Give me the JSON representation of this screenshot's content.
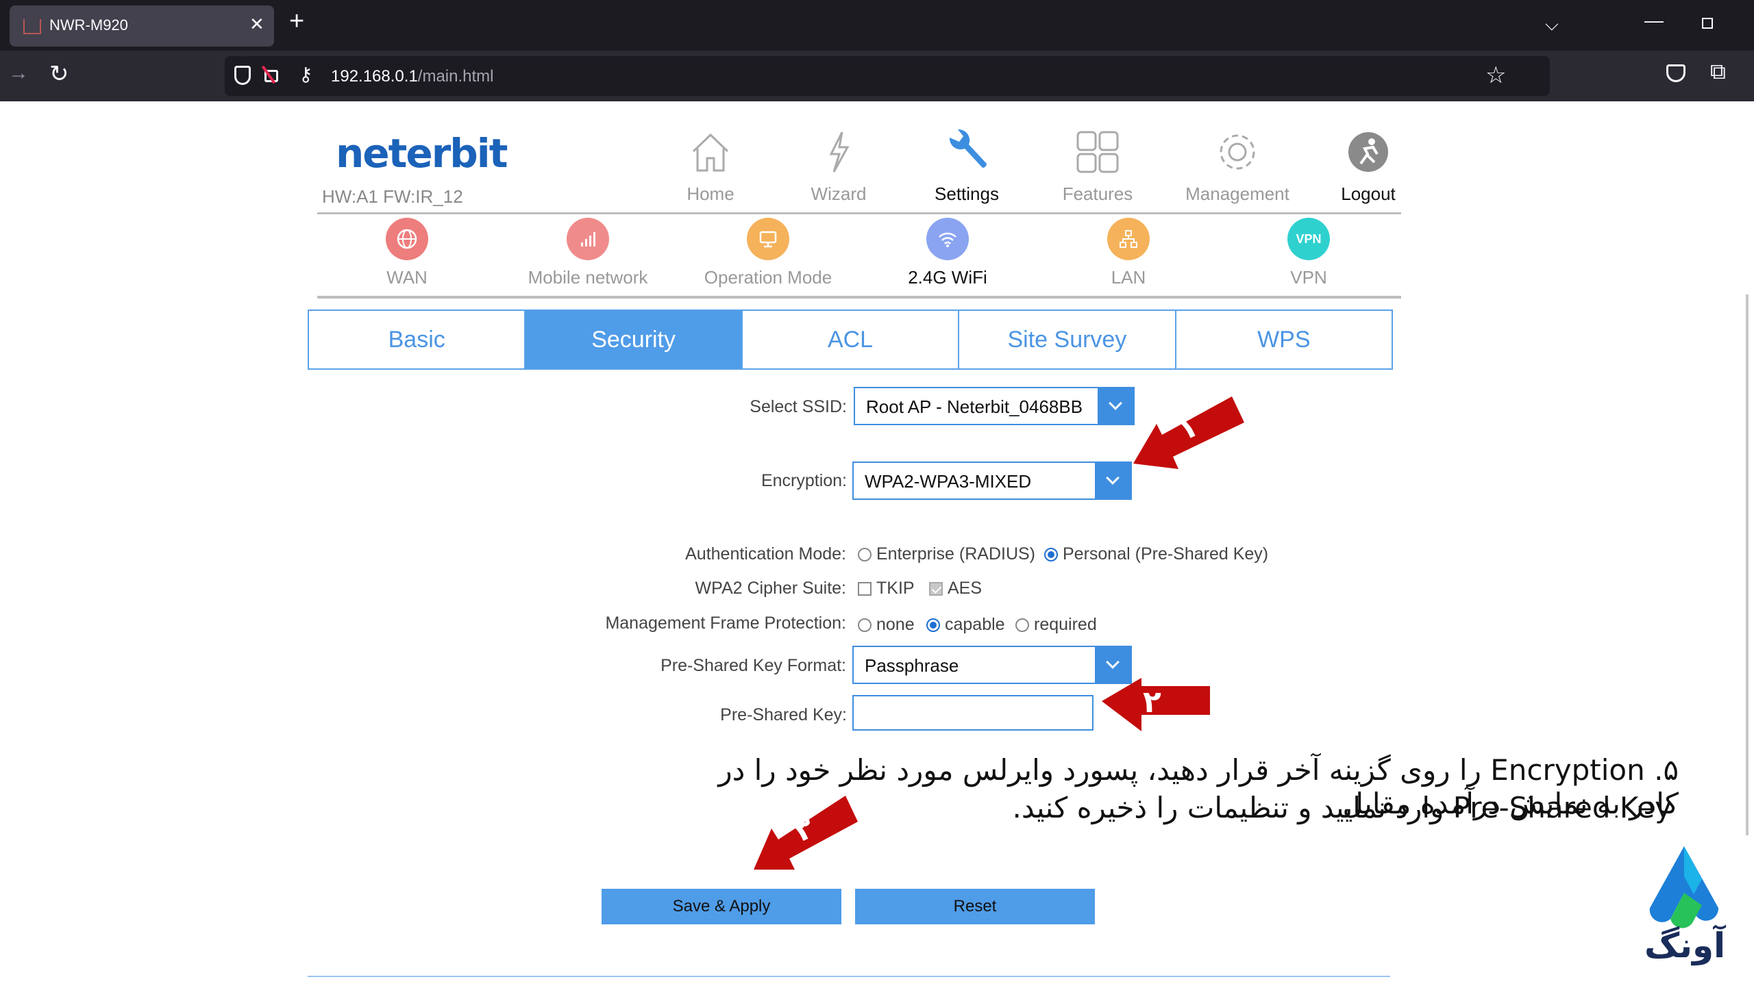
{
  "browser": {
    "tab_title": "NWR-M920",
    "url_host": "192.168.0.1",
    "url_path": "/main.html"
  },
  "router": {
    "logo": "neterbit",
    "hw_fw": "HW:A1 FW:IR_12",
    "top_nav": [
      {
        "label": "Home",
        "icon": "home-icon"
      },
      {
        "label": "Wizard",
        "icon": "wizard-icon"
      },
      {
        "label": "Settings",
        "icon": "wrench-icon",
        "active": true
      },
      {
        "label": "Features",
        "icon": "grid-icon"
      },
      {
        "label": "Management",
        "icon": "gear-icon"
      },
      {
        "label": "Logout",
        "icon": "logout-icon"
      }
    ],
    "sub_nav": [
      {
        "label": "WAN",
        "icon": "globe-icon",
        "color": "#ee7d7d"
      },
      {
        "label": "Mobile network",
        "icon": "signal-icon",
        "color": "#f08b8b"
      },
      {
        "label": "Operation Mode",
        "icon": "monitor-icon",
        "color": "#f5b25b"
      },
      {
        "label": "2.4G WiFi",
        "icon": "wifi-icon",
        "color": "#8aa4f1",
        "active": true
      },
      {
        "label": "LAN",
        "icon": "network-icon",
        "color": "#f5b25b"
      },
      {
        "label": "VPN",
        "icon": "vpn-icon",
        "color": "#2fd1cf",
        "badge": "VPN"
      }
    ],
    "tabs": [
      {
        "label": "Basic"
      },
      {
        "label": "Security",
        "active": true
      },
      {
        "label": "ACL"
      },
      {
        "label": "Site Survey"
      },
      {
        "label": "WPS"
      }
    ],
    "form": {
      "ssid_label": "Select SSID:",
      "ssid_value": "Root AP - Neterbit_0468BB",
      "encryption_label": "Encryption:",
      "encryption_value": "WPA2-WPA3-MIXED",
      "auth_label": "Authentication Mode:",
      "auth_enterprise": "Enterprise (RADIUS)",
      "auth_personal": "Personal (Pre-Shared Key)",
      "cipher_label": "WPA2 Cipher Suite:",
      "cipher_tkip": "TKIP",
      "cipher_aes": "AES",
      "mfp_label": "Management Frame Protection:",
      "mfp_none": "none",
      "mfp_capable": "capable",
      "mfp_required": "required",
      "psk_format_label": "Pre-Shared Key Format:",
      "psk_format_value": "Passphrase",
      "psk_label": "Pre-Shared Key:",
      "psk_value": ""
    },
    "buttons": {
      "save": "Save & Apply",
      "reset": "Reset"
    }
  },
  "annotation": {
    "line1": "۵. Encryption را روی گزینه آخر قرار دهید، پسورد وایرلس مورد نظر خود را در کادر به نمایش درآمده مقابل",
    "line2": "Pre-Shared Key وارد نمایید و تنظیمات را ذخیره کنید.",
    "arrow1": "۱",
    "arrow2": "۲",
    "arrow3": "۳",
    "brand": "آونگ"
  }
}
